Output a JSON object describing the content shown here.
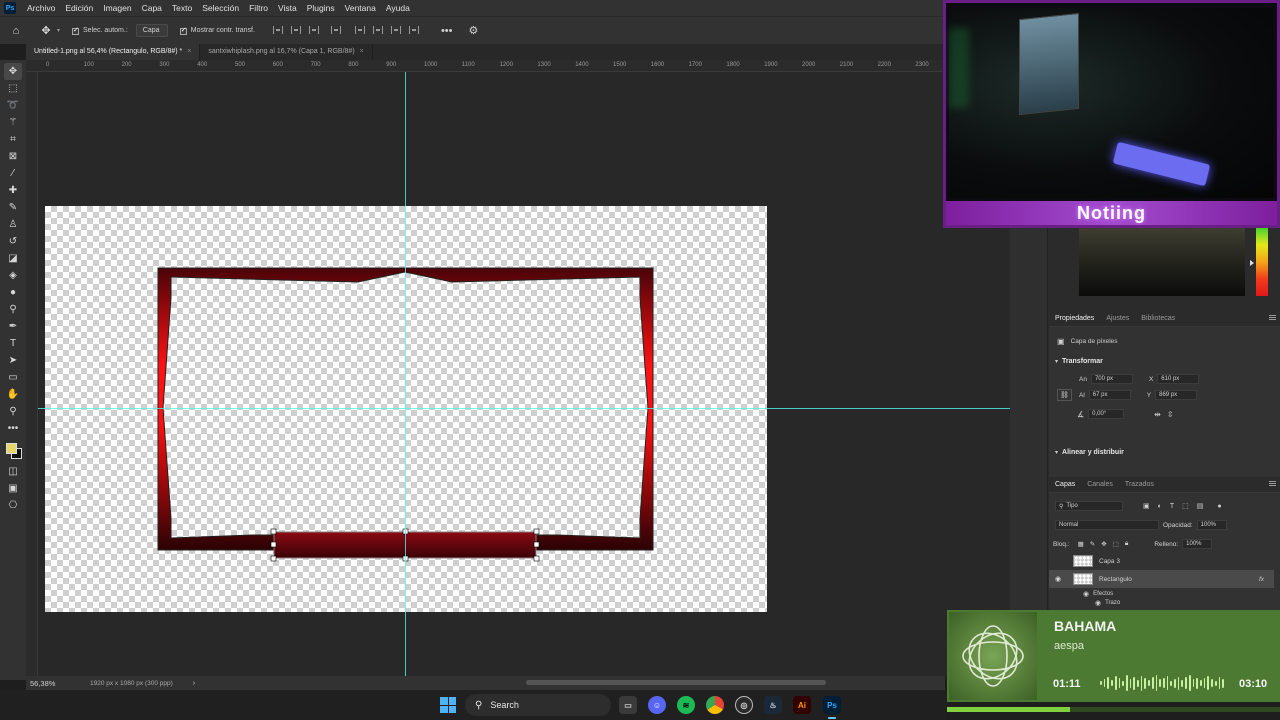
{
  "menubar": {
    "logo": "Ps",
    "items": [
      "Archivo",
      "Edición",
      "Imagen",
      "Capa",
      "Texto",
      "Selección",
      "Filtro",
      "Vista",
      "Plugins",
      "Ventana",
      "Ayuda"
    ]
  },
  "options": {
    "auto_select_label": "Selec. autom.:",
    "auto_select_value": "Capa",
    "show_transform_label": "Mostrar contr. transf."
  },
  "tabs": [
    {
      "label": "Untitled-1.png al 56,4% (Rectangulo, RGB/8#) *",
      "active": true
    },
    {
      "label": "santxiwhiplash.png al 16,7% (Capa 1, RGB/8#)",
      "active": false
    }
  ],
  "ruler_ticks": [
    "0",
    "100",
    "200",
    "300",
    "400",
    "500",
    "600",
    "700",
    "800",
    "900",
    "1000",
    "1100",
    "1200",
    "1300",
    "1400",
    "1500",
    "1600",
    "1700",
    "1800",
    "1900",
    "2000",
    "2100",
    "2200",
    "2300"
  ],
  "status": {
    "zoom": "56,38%",
    "doc_info": "1920 px x 1080 px (300 ppp)"
  },
  "colors": {
    "fg": "#e6d66a",
    "bg": "#111111",
    "frame_dark": "#4a0308",
    "frame_bright": "#ff1010",
    "guide": "#4ff5e6",
    "accent": "#6a1f86"
  },
  "panels": {
    "props_tabs": [
      "Propiedades",
      "Ajustes",
      "Bibliotecas"
    ],
    "pixel_layer": "Capa de píxeles",
    "transform_title": "Transformar",
    "an_label": "An",
    "an_value": "700 px",
    "x_label": "X",
    "x_value": "610 px",
    "al_label": "Al",
    "al_value": "67 px",
    "y_label": "Y",
    "y_value": "869 px",
    "angle_value": "0,00°",
    "align_title": "Alinear y distribuir",
    "layer_tabs": [
      "Capas",
      "Canales",
      "Trazados"
    ],
    "kind_filter": "Tipo",
    "blend_mode": "Normal",
    "opacity_label": "Opacidad:",
    "opacity_value": "100%",
    "lock_label": "Bloq.:",
    "fill_label": "Relleno:",
    "fill_value": "100%",
    "layers": [
      {
        "name": "Capa 3",
        "selected": false
      },
      {
        "name": "Rectangulo",
        "selected": true,
        "fx": "fx"
      }
    ],
    "effects_label": "Efectos",
    "stroke_label": "Trazo"
  },
  "webcam": {
    "banner_text": "Notiing"
  },
  "music": {
    "title": "BAHAMA",
    "artist": "aespa",
    "elapsed": "01:11",
    "duration": "03:10",
    "progress": 0.37
  },
  "taskbar": {
    "search_label": "Search",
    "apps": [
      "file-explorer",
      "discord",
      "spotify",
      "chrome",
      "obs",
      "steam",
      "illustrator",
      "photoshop"
    ],
    "ai_label": "Ai",
    "ps_label": "Ps"
  }
}
